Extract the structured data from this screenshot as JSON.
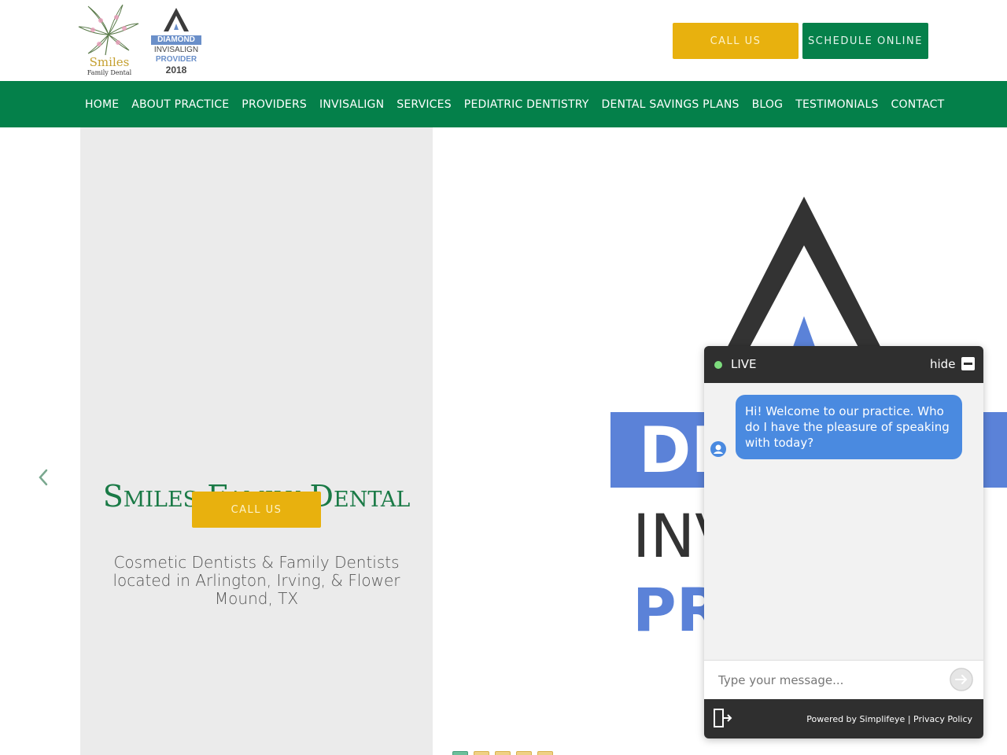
{
  "header": {
    "logo_name": "Smiles",
    "logo_sub": "Family Dental",
    "badge": {
      "line1": "DIAMOND",
      "line2": "INVISALIGN",
      "line3": "PROVIDER",
      "line4": "2018"
    },
    "call_label": "CALL US",
    "schedule_label": "SCHEDULE ONLINE"
  },
  "nav": {
    "items": [
      "HOME",
      "ABOUT PRACTICE",
      "PROVIDERS",
      "INVISALIGN",
      "SERVICES",
      "PEDIATRIC DENTISTRY",
      "DENTAL SAVINGS PLANS",
      "BLOG",
      "TESTIMONIALS",
      "CONTACT"
    ]
  },
  "hero": {
    "title": "Smiles Family Dental",
    "subtitle": "Cosmetic Dentists & Family Dentists located in Arlington, Irving, & Flower Mound, TX",
    "cta_label": "CALL US",
    "slide_count": 5,
    "active_slide": 1
  },
  "chat": {
    "status": "LIVE",
    "hide_label": "hide",
    "message": "Hi! Welcome to our practice.  Who do I have the pleasure of speaking with today?",
    "input_placeholder": "Type your message...",
    "powered_by": "Powered by Simplifeye",
    "privacy": "Privacy Policy"
  },
  "colors": {
    "brand_green": "#04804a",
    "accent_yellow": "#e8b10e",
    "chat_blue": "#4a8ae0"
  }
}
